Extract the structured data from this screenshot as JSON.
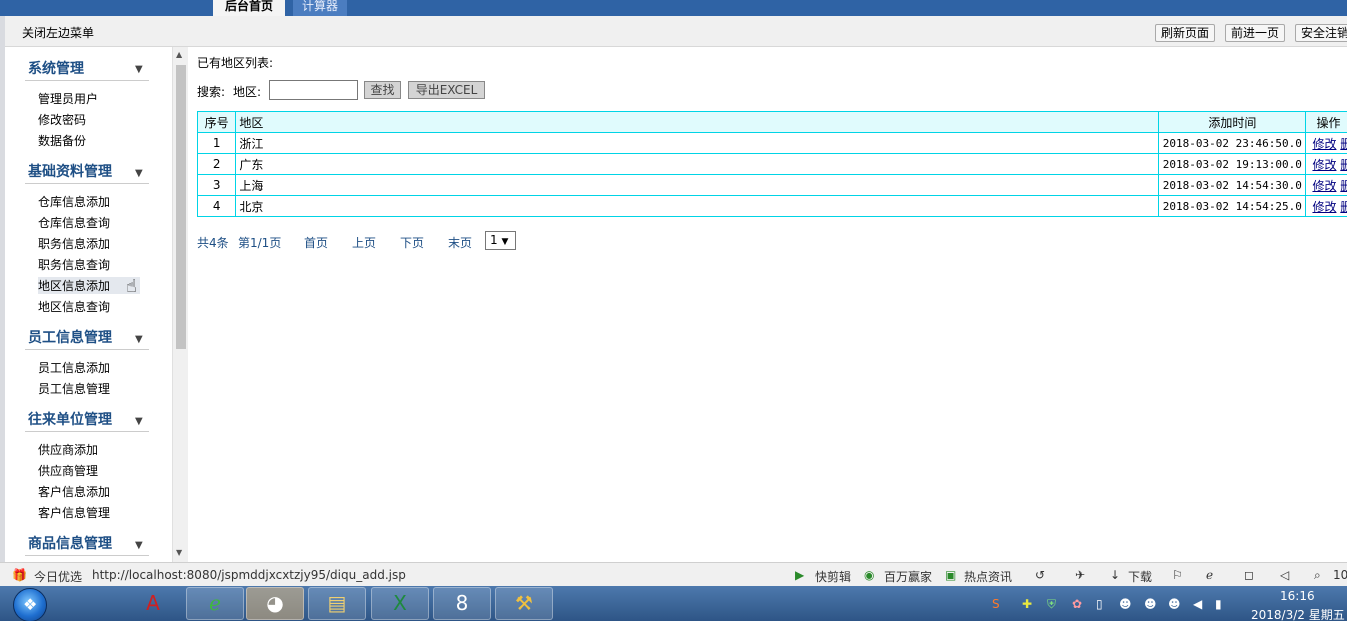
{
  "tabs": [
    "后台首页",
    "计算器"
  ],
  "toolbar": {
    "close_menu": "关闭左边菜单",
    "refresh": "刷新页面",
    "forward": "前进一页",
    "logout": "安全注销"
  },
  "sidebar": {
    "groups": [
      {
        "title": "系统管理",
        "items": [
          "管理员用户",
          "修改密码",
          "数据备份"
        ]
      },
      {
        "title": "基础资料管理",
        "items": [
          "仓库信息添加",
          "仓库信息查询",
          "职务信息添加",
          "职务信息查询",
          "地区信息添加",
          "地区信息查询"
        ]
      },
      {
        "title": "员工信息管理",
        "items": [
          "员工信息添加",
          "员工信息管理"
        ]
      },
      {
        "title": "往来单位管理",
        "items": [
          "供应商添加",
          "供应商管理",
          "客户信息添加",
          "客户信息管理"
        ]
      },
      {
        "title": "商品信息管理",
        "items": []
      }
    ]
  },
  "main": {
    "list_title": "已有地区列表:",
    "search_label": "搜索:",
    "region_label": "地区:",
    "search_value": "",
    "find_button": "查找",
    "export_button": "导出EXCEL",
    "table": {
      "headers": [
        "序号",
        "地区",
        "添加时间",
        "操作"
      ],
      "rows": [
        {
          "no": "1",
          "region": "浙江",
          "time": "2018-03-02 23:46:50.0"
        },
        {
          "no": "2",
          "region": "广东",
          "time": "2018-03-02 19:13:00.0"
        },
        {
          "no": "3",
          "region": "上海",
          "time": "2018-03-02 14:54:30.0"
        },
        {
          "no": "4",
          "region": "北京",
          "time": "2018-03-02 14:54:25.0"
        }
      ],
      "edit_label": "修改",
      "delete_label": "删除"
    },
    "pager": {
      "total": "共4条",
      "page_info": "第1/1页",
      "first": "首页",
      "prev": "上页",
      "next": "下页",
      "last": "末页",
      "select_value": "1"
    }
  },
  "statusbar": {
    "today": "今日优选",
    "url": "http://localhost:8080/jspmddjxcxtzjy95/diqu_add.jsp",
    "quick_edit": "快剪辑",
    "million": "百万赢家",
    "hot_news": "热点资讯",
    "download": "下载",
    "zoom": "10"
  },
  "taskbar": {
    "time": "16:16",
    "date": "2018/3/2 星期五"
  }
}
